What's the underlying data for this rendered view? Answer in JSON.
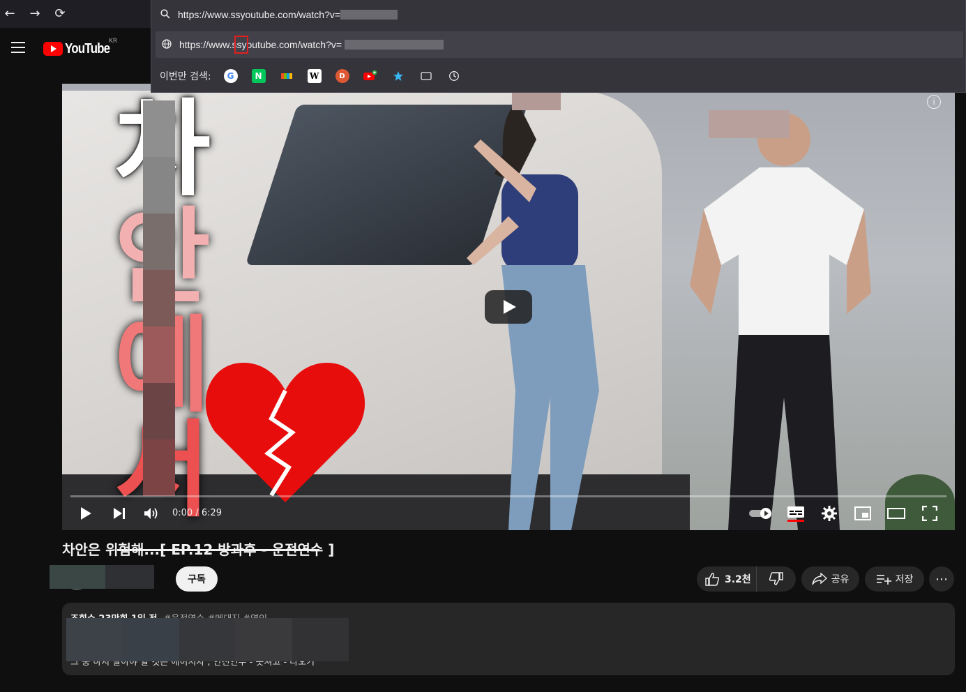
{
  "browser": {
    "back_label": "←",
    "forward_label": "→",
    "reload_label": "⟳"
  },
  "omnibox": {
    "suggestion_url": "https://www.ssyoutube.com/watch?v=",
    "typed_url_prefix": "https://www.",
    "typed_url_highlight": "ss",
    "typed_url_suffix": "youtube.com/watch?v=",
    "search_label": "이번만 검색:",
    "engines": [
      "google-icon",
      "naver-icon",
      "bing-icon",
      "wikipedia-icon",
      "duckduckgo-icon",
      "youtube-add-icon",
      "bookmark-star-icon",
      "tabs-icon",
      "history-icon"
    ]
  },
  "header": {
    "logo_text": "YouTube",
    "country": "KR"
  },
  "player": {
    "time": "0:00 / 6:29",
    "thumb_chars": [
      "차",
      "안",
      "에",
      "서"
    ]
  },
  "video": {
    "title": "차안은 위험해...[ EP.12 방과후 - 운전연수 ]",
    "subscribe_label": "구독",
    "like_count": "3.2천",
    "share_label": "공유",
    "save_label": "저장",
    "more_label": "⋯"
  },
  "description": {
    "meta": "조회수 23만회  1일 전",
    "tags": "#운전연수 #메대지 #연인",
    "line": "그 중 하지 말아야 할 것은 에이지자 , 안전연수 - 봇쳐고 - 나오기"
  },
  "colors": {
    "accent_red": "#ff0000",
    "background": "#0f0f0f",
    "pill_bg": "#272727",
    "omnibox_bg": "#35343b"
  }
}
